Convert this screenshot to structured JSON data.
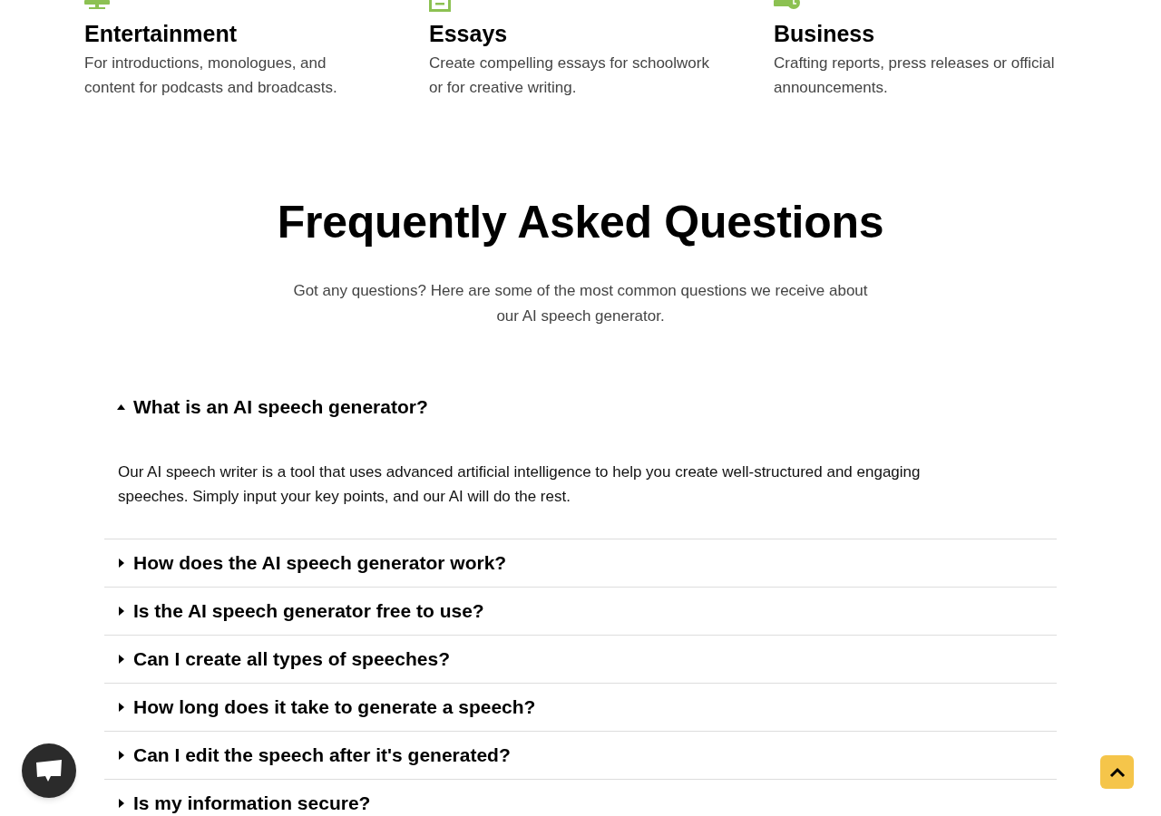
{
  "use_cases": [
    {
      "title": "Entertainment",
      "description": "For introductions, monologues, and content for podcasts and broadcasts."
    },
    {
      "title": "Essays",
      "description": "Create compelling essays for schoolwork or for creative writing."
    },
    {
      "title": "Business",
      "description": "Crafting reports, press releases or official announcements."
    }
  ],
  "faq": {
    "title": "Frequently Asked Questions",
    "subtitle": "Got any questions? Here are some of the most common questions we receive about our AI speech generator.",
    "items": [
      {
        "question": "What is an AI speech generator?",
        "expanded": true,
        "answer": "Our AI speech writer is a tool that uses advanced artificial intelligence to help you create well-structured and engaging speeches. Simply input your key points, and our AI will do the rest."
      },
      {
        "question": "How does the AI speech generator work?",
        "expanded": false
      },
      {
        "question": "Is the AI speech generator free to use?",
        "expanded": false
      },
      {
        "question": "Can I create all types of speeches?",
        "expanded": false
      },
      {
        "question": "How long does it take to generate a speech?",
        "expanded": false
      },
      {
        "question": "Can I edit the speech after it's generated?",
        "expanded": false
      },
      {
        "question": "Is my information secure?",
        "expanded": false
      }
    ]
  }
}
